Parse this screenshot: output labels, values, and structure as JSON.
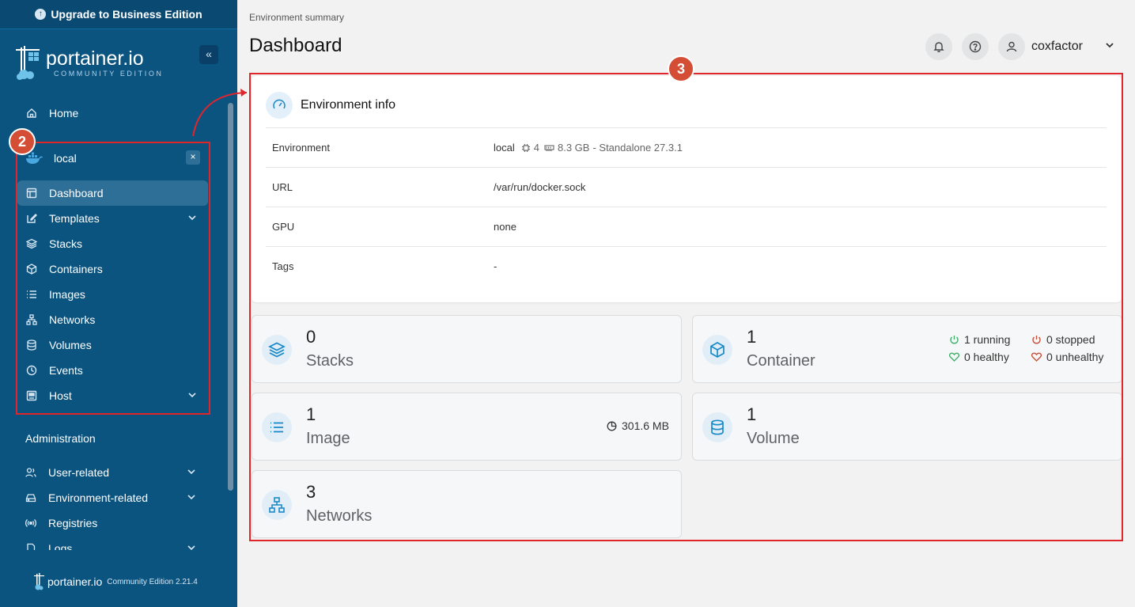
{
  "sidebar": {
    "upgrade_label": "Upgrade to Business Edition",
    "brand": "portainer.io",
    "brand_sub": "COMMUNITY EDITION",
    "home_label": "Home",
    "environment_name": "local",
    "env_items": [
      {
        "label": "Dashboard",
        "icon": "dashboard-icon"
      },
      {
        "label": "Templates",
        "icon": "templates-icon"
      },
      {
        "label": "Stacks",
        "icon": "stacks-icon"
      },
      {
        "label": "Containers",
        "icon": "containers-icon"
      },
      {
        "label": "Images",
        "icon": "images-icon"
      },
      {
        "label": "Networks",
        "icon": "networks-icon"
      },
      {
        "label": "Volumes",
        "icon": "volumes-icon"
      },
      {
        "label": "Events",
        "icon": "events-icon"
      },
      {
        "label": "Host",
        "icon": "host-icon"
      }
    ],
    "admin_title": "Administration",
    "admin_items": [
      {
        "label": "User-related"
      },
      {
        "label": "Environment-related"
      },
      {
        "label": "Registries"
      },
      {
        "label": "Logs"
      }
    ],
    "footer_brand": "portainer.io",
    "footer_version": "Community Edition 2.21.4"
  },
  "annotations": {
    "badge_2": "2",
    "badge_3": "3"
  },
  "header": {
    "breadcrumb": "Environment summary",
    "title": "Dashboard",
    "username": "coxfactor"
  },
  "env_info": {
    "title": "Environment info",
    "rows": [
      {
        "key": "Environment",
        "value": "local",
        "cpu": "4",
        "memory": "8.3 GB",
        "suffix": "- Standalone 27.3.1"
      },
      {
        "key": "URL",
        "value": "/var/run/docker.sock"
      },
      {
        "key": "GPU",
        "value": "none"
      },
      {
        "key": "Tags",
        "value": "-"
      }
    ]
  },
  "stats": {
    "stacks": {
      "count": "0",
      "label": "Stacks"
    },
    "containers": {
      "count": "1",
      "label": "Container",
      "running": "1 running",
      "stopped": "0 stopped",
      "healthy": "0 healthy",
      "unhealthy": "0 unhealthy"
    },
    "images": {
      "count": "1",
      "label": "Image",
      "size": "301.6 MB"
    },
    "volumes": {
      "count": "1",
      "label": "Volume"
    },
    "networks": {
      "count": "3",
      "label": "Networks"
    }
  },
  "colors": {
    "sidebar": "#0b5480",
    "accent": "#1a8ac6",
    "annotation": "#e0252b",
    "green": "#3fb16b",
    "red": "#c9503a"
  }
}
